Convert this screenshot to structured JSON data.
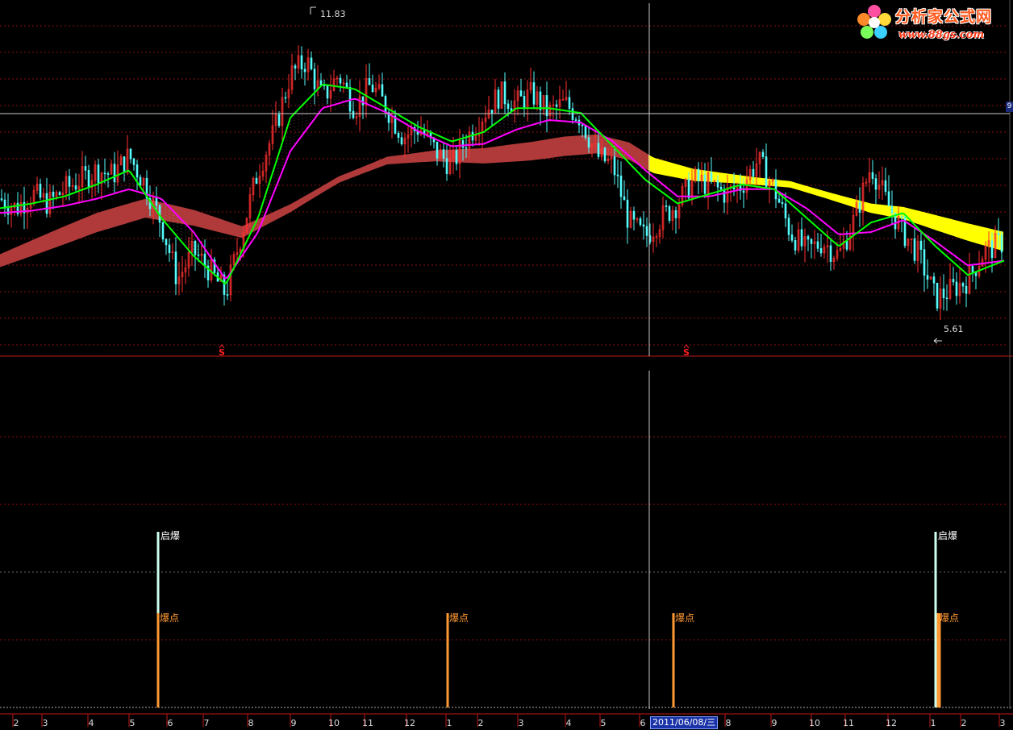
{
  "watermark": {
    "title": "分析家公式网",
    "url": "www.88gs.com"
  },
  "cursor": {
    "date_label": "2011/06/08/三"
  },
  "axis_tag": "9",
  "colors": {
    "background": "#000000",
    "grid": "#8a1010",
    "up_candle": "#ff3030",
    "down_candle": "#54fcfc",
    "ema_fast": "#00ff00",
    "ema_slow": "#ff00ff",
    "ribbon_long": "#b03a3a",
    "ribbon_long_alt": "#ffff00",
    "signal_qibao": "#ccffee",
    "signal_baodian": "#ff9933",
    "sell_marker": "#ff2020"
  },
  "chart_data": [
    {
      "type": "candlestick",
      "panel": "main",
      "price_high_label": "11.83",
      "price_low_label": "5.61",
      "ylim": [
        5.2,
        12.3
      ],
      "grid": true,
      "series": [
        {
          "key": "close",
          "x": [
            0,
            20,
            40,
            60,
            80,
            100,
            120,
            140,
            160,
            180,
            200,
            220,
            240,
            260,
            280,
            300,
            320,
            340,
            360,
            380,
            400,
            420,
            440,
            460,
            480,
            500,
            520,
            540,
            560,
            580,
            600,
            620,
            640,
            660,
            680,
            700,
            720,
            740,
            760,
            780,
            800,
            820,
            840,
            860,
            880,
            900,
            920,
            940,
            960,
            980,
            1000,
            1020,
            1040,
            1060,
            1080,
            1100,
            1120,
            1140,
            1160,
            1180,
            1200,
            1220,
            1245
          ],
          "values": [
            8.3,
            8.1,
            8.4,
            8.2,
            8.5,
            8.7,
            8.9,
            8.8,
            9.2,
            8.6,
            7.8,
            6.6,
            7.2,
            6.8,
            6.3,
            7.6,
            8.9,
            9.7,
            10.9,
            11.2,
            10.4,
            10.9,
            10.2,
            10.7,
            10.2,
            9.6,
            9.8,
            9.3,
            9.0,
            9.6,
            10.1,
            10.5,
            10.3,
            10.5,
            10.1,
            10.3,
            10.0,
            9.2,
            9.0,
            7.8,
            7.5,
            7.9,
            8.2,
            8.7,
            8.6,
            8.4,
            8.6,
            9.1,
            8.5,
            7.6,
            7.2,
            7.4,
            7.1,
            7.9,
            9.0,
            8.2,
            7.6,
            7.1,
            6.2,
            6.4,
            6.6,
            7.2,
            7.4
          ]
        },
        {
          "key": "ema_fast",
          "x": [
            0,
            40,
            80,
            120,
            160,
            200,
            240,
            280,
            320,
            360,
            400,
            440,
            480,
            520,
            560,
            600,
            640,
            680,
            720,
            760,
            800,
            840,
            880,
            920,
            960,
            1000,
            1040,
            1080,
            1120,
            1160,
            1200,
            1245
          ],
          "values": [
            8.1,
            8.2,
            8.35,
            8.6,
            8.9,
            7.9,
            7.1,
            6.5,
            7.9,
            10.0,
            10.7,
            10.6,
            10.2,
            9.8,
            9.5,
            9.7,
            10.2,
            10.2,
            10.1,
            9.4,
            8.7,
            8.2,
            8.4,
            8.6,
            8.5,
            7.9,
            7.3,
            7.8,
            8.0,
            7.3,
            6.7,
            7.0
          ]
        },
        {
          "key": "ema_slow",
          "x": [
            0,
            40,
            80,
            120,
            160,
            200,
            240,
            280,
            320,
            360,
            400,
            440,
            480,
            520,
            560,
            600,
            640,
            680,
            720,
            760,
            800,
            840,
            880,
            920,
            960,
            1000,
            1040,
            1080,
            1120,
            1160,
            1200,
            1245
          ],
          "values": [
            8.0,
            8.05,
            8.15,
            8.3,
            8.5,
            8.3,
            7.6,
            6.6,
            7.6,
            9.3,
            10.2,
            10.4,
            10.1,
            9.7,
            9.4,
            9.45,
            9.75,
            9.95,
            9.9,
            9.5,
            8.9,
            8.35,
            8.35,
            8.5,
            8.5,
            8.1,
            7.55,
            7.6,
            7.85,
            7.4,
            6.9,
            7.0
          ]
        },
        {
          "key": "ribbon_long",
          "x": [
            0,
            60,
            120,
            180,
            240,
            300,
            360,
            420,
            480,
            540,
            600,
            660,
            700,
            740,
            780,
            810,
            860,
            920,
            980,
            1040,
            1080,
            1120,
            1160,
            1200,
            1245
          ],
          "values": [
            7.0,
            7.4,
            7.8,
            8.1,
            7.9,
            7.6,
            8.1,
            8.7,
            9.1,
            9.2,
            9.2,
            9.3,
            9.4,
            9.45,
            9.3,
            9.0,
            8.8,
            8.7,
            8.6,
            8.3,
            8.1,
            8.0,
            7.8,
            7.6,
            7.4
          ]
        }
      ],
      "sell_markers_x": [
        275,
        851
      ]
    },
    {
      "type": "bar",
      "panel": "signal",
      "series": [
        {
          "name": "启爆",
          "x": [
            196,
            1160
          ],
          "values": [
            1,
            1
          ]
        },
        {
          "name": "爆点",
          "x": [
            196,
            555,
            835,
            1163
          ],
          "values": [
            0.5,
            0.5,
            0.5,
            0.5
          ]
        }
      ],
      "ylim": [
        0,
        1
      ]
    },
    {
      "type": "axis",
      "panel": "x-axis",
      "tick_labels": [
        "2",
        "3",
        "4",
        "5",
        "6",
        "7",
        "8",
        "9",
        "10",
        "11",
        "12",
        "1",
        "2",
        "3",
        "4",
        "5",
        "6",
        "8",
        "9",
        "10",
        "11",
        "12",
        "1",
        "2",
        "3"
      ],
      "tick_x": [
        20,
        56,
        113,
        164,
        211,
        256,
        311,
        364,
        414,
        456,
        508,
        557,
        596,
        646,
        705,
        748,
        797,
        903,
        960,
        1010,
        1052,
        1105,
        1157,
        1195,
        1243
      ]
    }
  ]
}
